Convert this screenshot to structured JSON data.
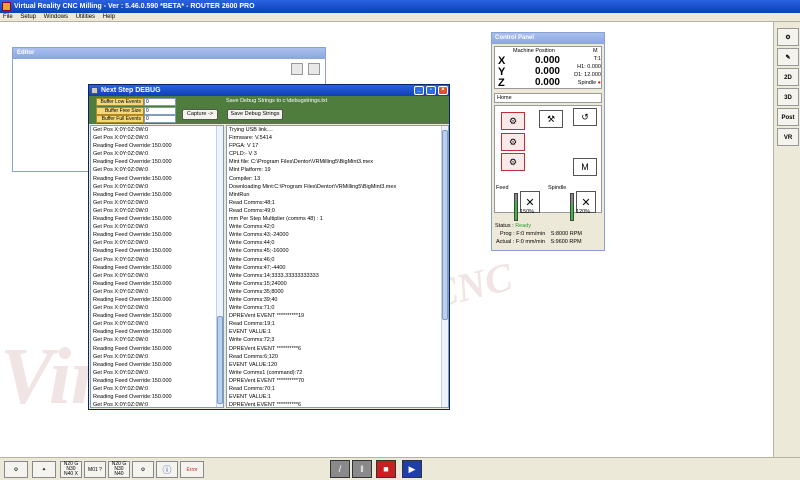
{
  "app": {
    "title": "Virtual Reality CNC Milling  -  Ver : 5.46.0.590 *BETA*  -  ROUTER 2600 PRO",
    "menu": [
      "File",
      "Setup",
      "Windows",
      "Utilities",
      "Help"
    ]
  },
  "editor": {
    "title": "Editor"
  },
  "debug": {
    "title": "Next Step DEBUG",
    "buffers": [
      {
        "label": "Buffer Low Events",
        "value": "0"
      },
      {
        "label": "Buffer Free Size",
        "value": "0"
      },
      {
        "label": "Buffer Full Events",
        "value": "0"
      }
    ],
    "capture_label": "Capture ->",
    "save_hint": "Save Debug Strings to c:\\debugstrings.txt",
    "save_button": "Save Debug Strings",
    "left_list": [
      "Get Pos X:0Y:0Z:0W:0",
      "Get Pos X:0Y:0Z:0W:0",
      "Reading Feed Override:150.000",
      "Get Pos X:0Y:0Z:0W:0",
      "Reading Feed Override:150.000",
      "Get Pos X:0Y:0Z:0W:0",
      "Reading Feed Override:150.000",
      "Get Pos X:0Y:0Z:0W:0",
      "Reading Feed Override:150.000",
      "Get Pos X:0Y:0Z:0W:0",
      "Get Pos X:0Y:0Z:0W:0",
      "Reading Feed Override:150.000",
      "Get Pos X:0Y:0Z:0W:0",
      "Reading Feed Override:150.000",
      "Get Pos X:0Y:0Z:0W:0",
      "Reading Feed Override:150.000",
      "Get Pos X:0Y:0Z:0W:0",
      "Reading Feed Override:150.000",
      "Get Pos X:0Y:0Z:0W:0",
      "Reading Feed Override:150.000",
      "Get Pos X:0Y:0Z:0W:0",
      "Reading Feed Override:150.000",
      "Get Pos X:0Y:0Z:0W:0",
      "Reading Feed Override:150.000",
      "Get Pos X:0Y:0Z:0W:0",
      "Reading Feed Override:150.000",
      "Get Pos X:0Y:0Z:0W:0",
      "Reading Feed Override:150.000",
      "Get Pos X:0Y:0Z:0W:0",
      "Reading Feed Override:150.000",
      "Get Pos X:0Y:0Z:0W:0",
      "Reading Feed Override:150.000",
      "Get Pos X:0Y:0Z:0W:0",
      "Reading Feed Override:150.000",
      "Get Pos X:0Y:0Z:0W:0",
      "Reading Feed Override:150.000"
    ],
    "right_list": [
      "Trying USB link....",
      "Firmware: V.5414",
      "FPGA: V 17",
      "CPLD:- V 3",
      "Mint file: C:\\Program Files\\Dentor\\VRMilling5\\BigMint3.mex",
      "Mint Platform: 19",
      "Compiler: 13",
      "Downloading Mint:C:\\Program Files\\Dentor\\VRMilling5\\BigMint3.mex",
      "MintRun",
      "Read Comms:48;1",
      "Read Comms:49;0",
      "mm Per Step Multiplier (comms 48) : 1",
      "Write Comms:42;0",
      "Write Comms:43;-24000",
      "Write Comms:44;0",
      "Write Comms:45;-16000",
      "Write Comms:46;0",
      "Write Comms:47;-4400",
      "Write Comms:14;3333.33333333333",
      "Write Comms:15;24000",
      "Write Comms:35;8000",
      "Write Comms:39;40",
      "Write Comms:71;0",
      "DPREVent EVENT **********19",
      "Read Comms:19;1",
      "EVENT VALUE:1",
      "Write Comms:72;3",
      "DPREVent EVENT **********6",
      "Read Comms:6;120",
      "EVENT VALUE:120",
      "Write Comms1 (command):72",
      "DPREVent EVENT **********70",
      "Read Comms:70;1",
      "EVENT VALUE:1",
      "DPREVent EVENT **********6",
      "Read Comms:6;120",
      "EVENT VALUE:120",
      "Write Comms:36;1",
      "Write Comms1 (command):36",
      "Write Comms:8;1",
      "Write Comms:9;1",
      "Write Comms:10;0",
      "Write Comms:34;0",
      "Write Comms:38;0",
      "Setup Controller and Check ATC"
    ]
  },
  "control_panel": {
    "title": "Control Panel",
    "machine_position": "Machine Position",
    "mode": "M",
    "axes": [
      {
        "name": "X",
        "value": "0.000"
      },
      {
        "name": "Y",
        "value": "0.000"
      },
      {
        "name": "Z",
        "value": "0.000"
      }
    ],
    "tool_info": [
      "T:1",
      "H1: 0.000",
      "D1: 12.000",
      "Spindle"
    ],
    "home_label": "Home",
    "feed_label": "Feed",
    "spindle_label": "Spindle",
    "feed_override": "150%",
    "spindle_override": "120%",
    "feed_level": 0.75,
    "spindle_level": 0.6,
    "status_label": "Status :",
    "status_value": "Ready",
    "prog_label": "Prog :",
    "prog_feed": "F:0 mm/min",
    "prog_spindle": "S:8000 RPM",
    "actual_label": "Actual :",
    "actual_feed": "F:0 mm/min",
    "actual_spindle": "S:9600 RPM",
    "status_color": "#2f9c2f"
  },
  "right_toolbar": [
    "2D",
    "3D",
    "Post",
    "VR"
  ],
  "bottom_bar": {
    "modal1": "N20 G\nN30\nN40 X",
    "modal2": "M01 ?",
    "modal3": "N20 G\nN30\nN40",
    "label_error": "Error",
    "colors": {
      "stop": "#c62020",
      "play": "#1f3fa8"
    }
  }
}
